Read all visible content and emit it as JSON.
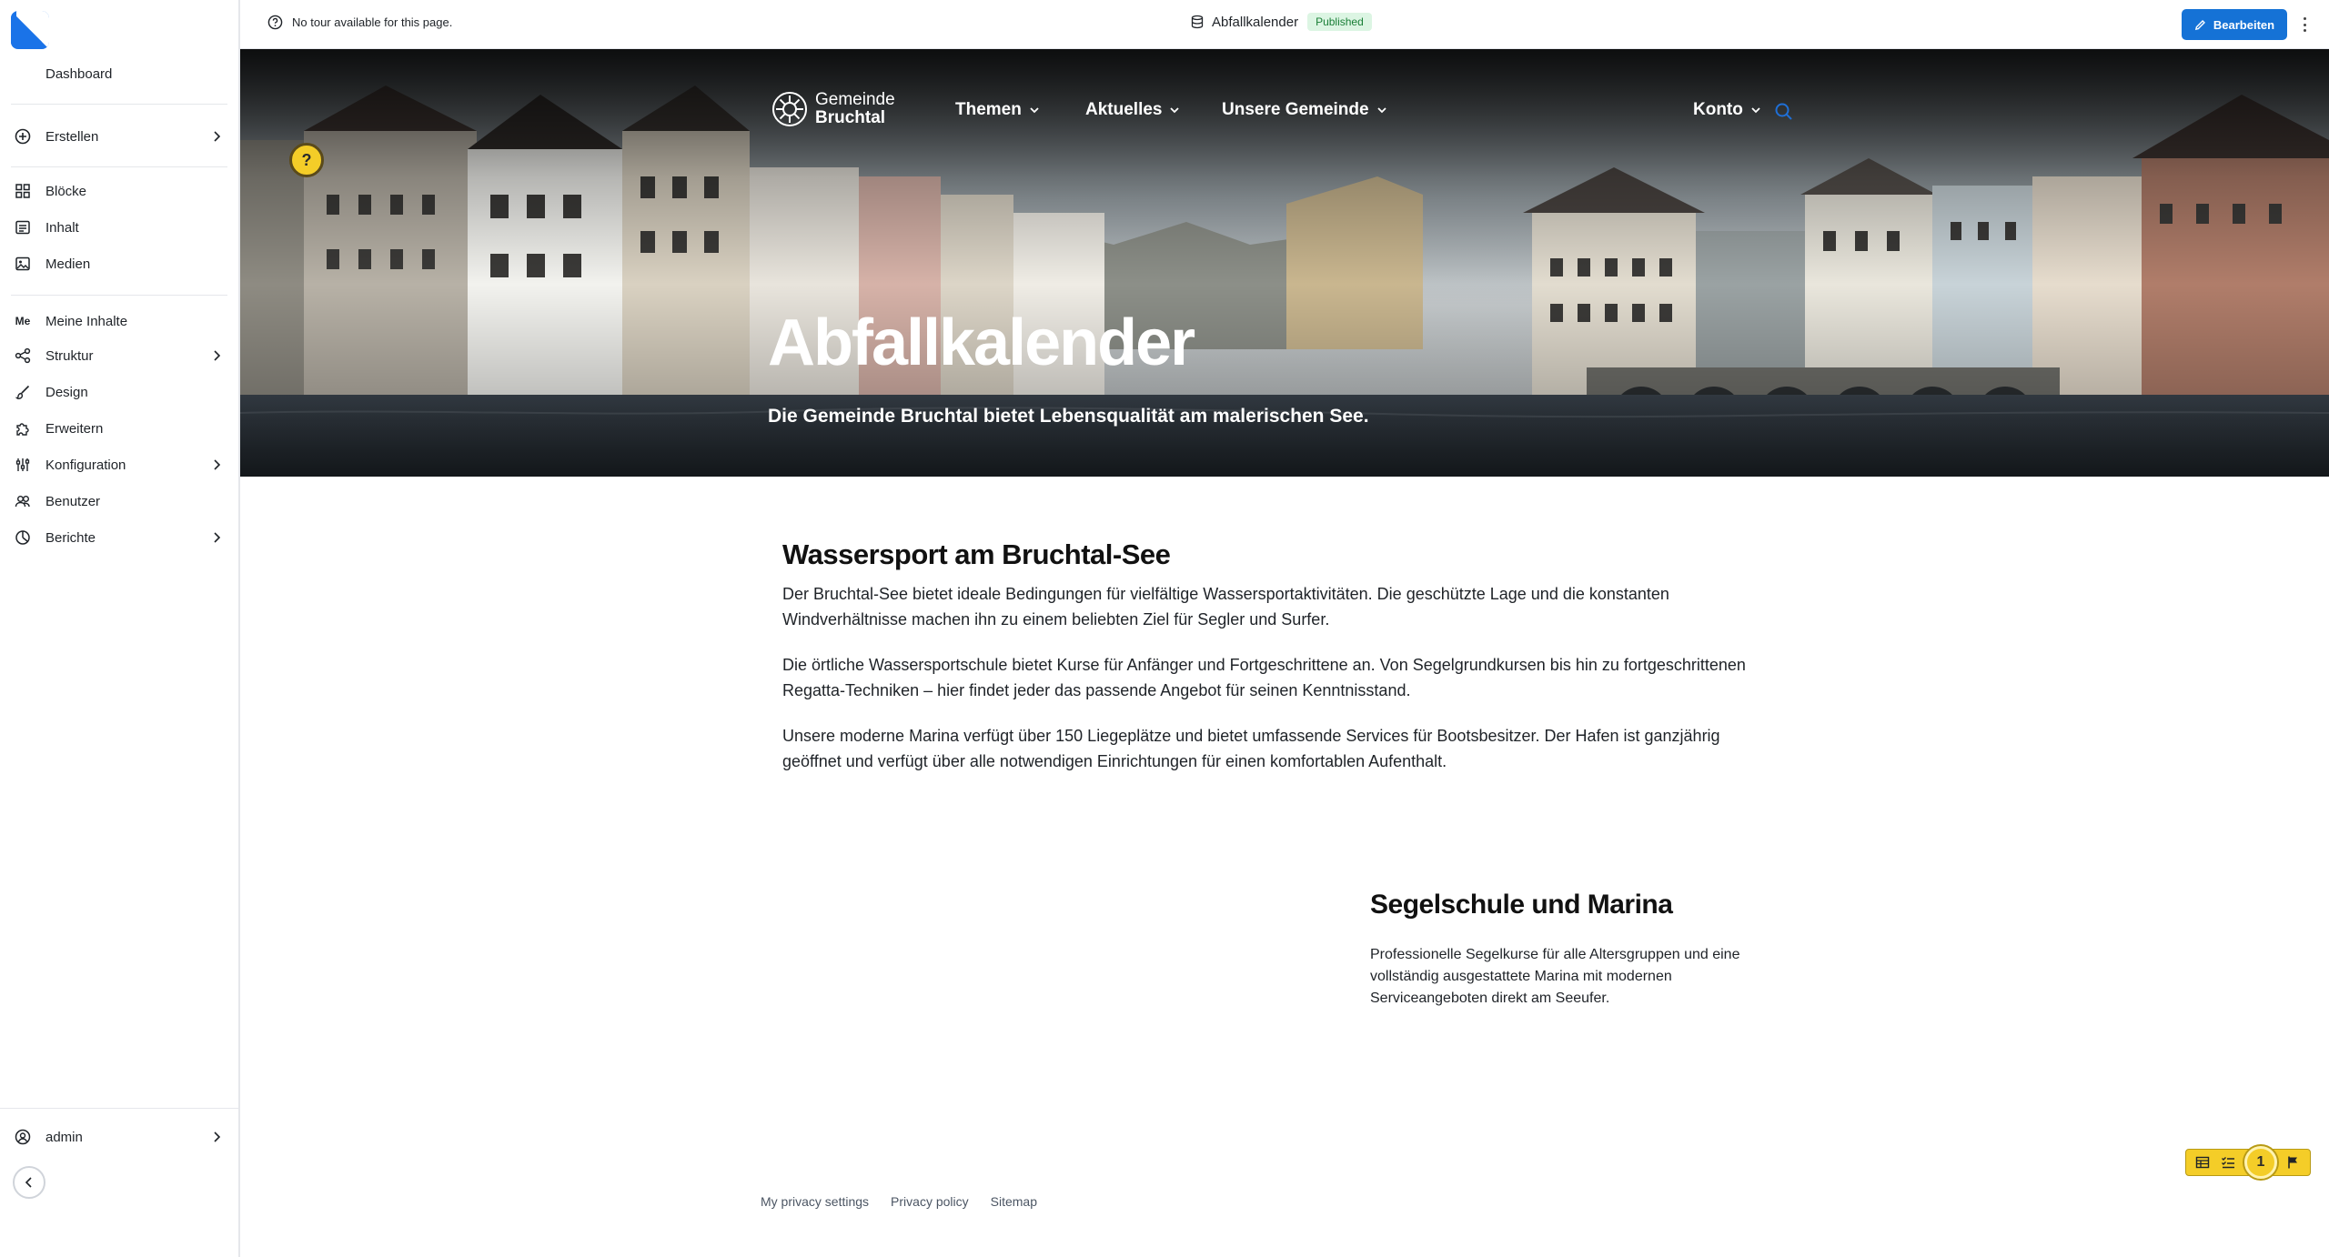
{
  "sidebar": {
    "dashboard_label": "Dashboard",
    "items": [
      {
        "label": "Erstellen",
        "icon": "plus-circle-icon",
        "has_submenu": true
      },
      {
        "label": "Blöcke",
        "icon": "grid-icon",
        "has_submenu": false
      },
      {
        "label": "Inhalt",
        "icon": "list-icon",
        "has_submenu": false
      },
      {
        "label": "Medien",
        "icon": "image-icon",
        "has_submenu": false
      },
      {
        "label": "Meine Inhalte",
        "icon": "me-badge",
        "badge": "Me",
        "has_submenu": false
      },
      {
        "label": "Struktur",
        "icon": "structure-icon",
        "has_submenu": true
      },
      {
        "label": "Design",
        "icon": "brush-icon",
        "has_submenu": false
      },
      {
        "label": "Erweitern",
        "icon": "puzzle-icon",
        "has_submenu": false
      },
      {
        "label": "Konfiguration",
        "icon": "sliders-icon",
        "has_submenu": true
      },
      {
        "label": "Benutzer",
        "icon": "users-icon",
        "has_submenu": false
      },
      {
        "label": "Berichte",
        "icon": "chart-icon",
        "has_submenu": true
      }
    ],
    "user_label": "admin"
  },
  "topbar": {
    "tour_text": "No tour available for this page.",
    "doc_title": "Abfallkalender",
    "status": "Published",
    "edit_label": "Bearbeiten"
  },
  "site": {
    "logo_line1": "Gemeinde",
    "logo_line2": "Bruchtal",
    "nav": [
      "Themen",
      "Aktuelles",
      "Unsere Gemeinde"
    ],
    "account_label": "Konto",
    "help_glyph": "?"
  },
  "hero": {
    "title": "Abfallkalender",
    "subtitle": "Die Gemeinde Bruchtal bietet Lebensqualität am malerischen See."
  },
  "content": {
    "heading": "Wassersport am Bruchtal-See",
    "paragraphs": [
      "Der Bruchtal-See bietet ideale Bedingungen für vielfältige Wassersportaktivitäten. Die geschützte Lage und die konstanten Windverhältnisse machen ihn zu einem beliebten Ziel für Segler und Surfer.",
      "Die örtliche Wassersportschule bietet Kurse für Anfänger und Fortgeschrittene an. Von Segelgrundkursen bis hin zu fortgeschrittenen Regatta-Techniken – hier findet jeder das passende Angebot für seinen Kenntnisstand.",
      "Unsere moderne Marina verfügt über 150 Liegeplätze und bietet umfassende Services für Bootsbesitzer. Der Hafen ist ganzjährig geöffnet und verfügt über alle notwendigen Einrichtungen für einen komfortablen Aufenthalt."
    ],
    "card_heading": "Segelschule und Marina",
    "card_text": "Professionelle Segelkurse für alle Altersgruppen und eine vollständig ausgestattete Marina mit modernen Serviceangeboten direkt am Seeufer."
  },
  "footer": {
    "links": [
      "My privacy settings",
      "Privacy policy",
      "Sitemap"
    ]
  },
  "toolbar": {
    "count": "1"
  },
  "colors": {
    "accent": "#1572d6",
    "published_bg": "#dcf5e3",
    "published_fg": "#1a7f37",
    "help_yellow": "#f4cd28"
  }
}
